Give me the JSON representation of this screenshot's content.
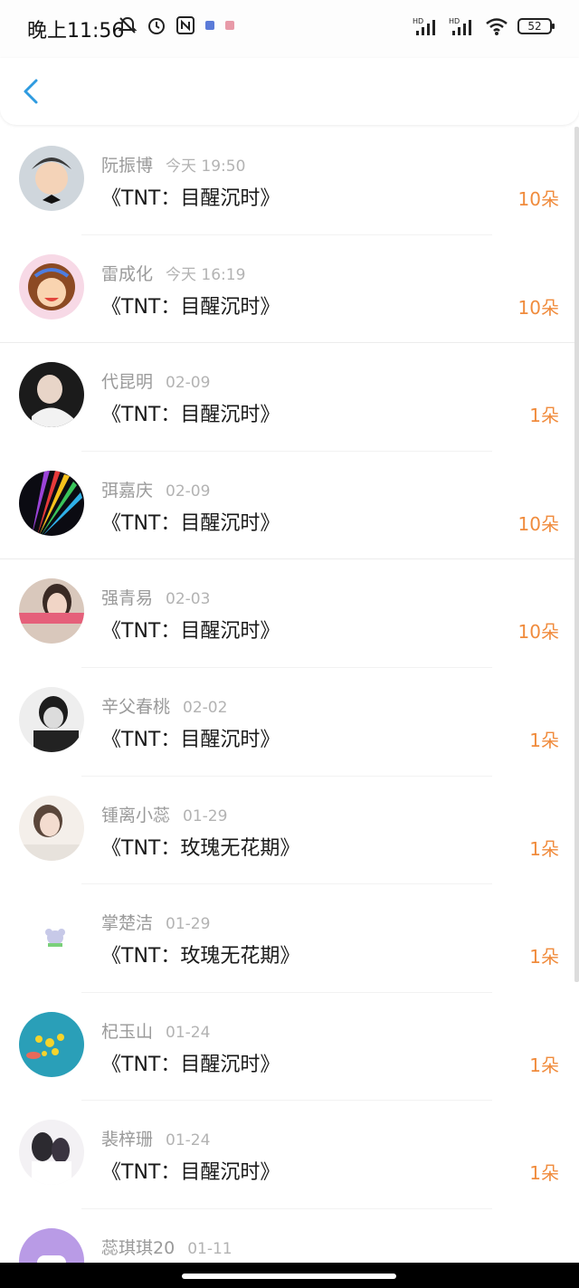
{
  "status_bar": {
    "time": "晚上11:56",
    "battery": "52",
    "signal_label_1": "HD",
    "signal_label_2": "HD"
  },
  "header": {
    "back_icon": "chevron-left-icon"
  },
  "colors": {
    "accent": "#2f9be0",
    "count": "#f08b3c",
    "name": "#9a9a9a",
    "title": "#1a1a1a"
  },
  "items": [
    {
      "name": "阮振博",
      "date": "今天 19:50",
      "title": "《TNT：目醒沉时》",
      "count": "10朵"
    },
    {
      "name": "雷成化",
      "date": "今天 16:19",
      "title": "《TNT：目醒沉时》",
      "count": "10朵"
    },
    {
      "name": "代昆明",
      "date": "02-09",
      "title": "《TNT：目醒沉时》",
      "count": "1朵"
    },
    {
      "name": "弭嘉庆",
      "date": "02-09",
      "title": "《TNT：目醒沉时》",
      "count": "10朵"
    },
    {
      "name": "强青易",
      "date": "02-03",
      "title": "《TNT：目醒沉时》",
      "count": "10朵"
    },
    {
      "name": "辛父春桃",
      "date": "02-02",
      "title": "《TNT：目醒沉时》",
      "count": "1朵"
    },
    {
      "name": "锺离小蕊",
      "date": "01-29",
      "title": "《TNT：玫瑰无花期》",
      "count": "1朵"
    },
    {
      "name": "掌楚洁",
      "date": "01-29",
      "title": "《TNT：玫瑰无花期》",
      "count": "1朵"
    },
    {
      "name": "杞玉山",
      "date": "01-24",
      "title": "《TNT：目醒沉时》",
      "count": "1朵"
    },
    {
      "name": "裴梓珊",
      "date": "01-24",
      "title": "《TNT：目醒沉时》",
      "count": "1朵"
    },
    {
      "name": "蕊琪琪20",
      "date": "01-11",
      "title": "",
      "count": ""
    }
  ]
}
